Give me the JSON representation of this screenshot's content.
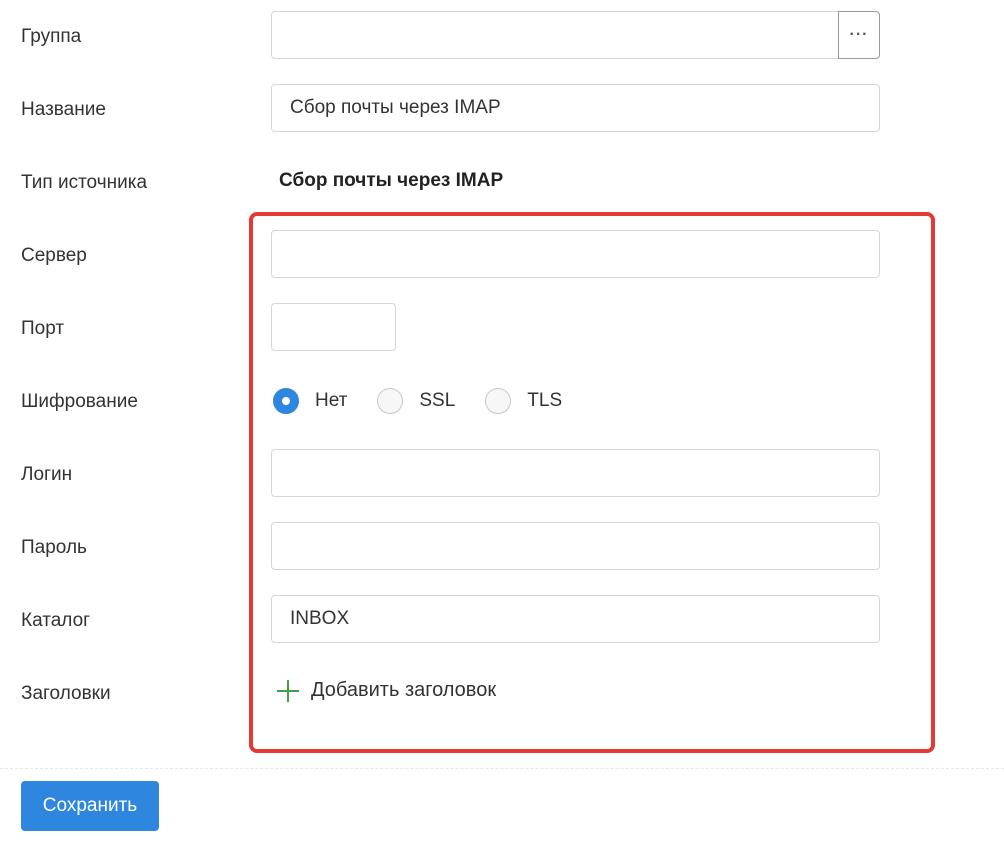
{
  "form": {
    "group": {
      "label": "Группа",
      "value": "",
      "browse_button": "···"
    },
    "name": {
      "label": "Название",
      "value": "Сбор почты через IMAP"
    },
    "source_type": {
      "label": "Тип источника",
      "value": "Сбор почты через IMAP"
    },
    "server": {
      "label": "Сервер",
      "value": ""
    },
    "port": {
      "label": "Порт",
      "value": ""
    },
    "encryption": {
      "label": "Шифрование",
      "options": [
        "Нет",
        "SSL",
        "TLS"
      ],
      "selected": "Нет"
    },
    "login": {
      "label": "Логин",
      "value": ""
    },
    "password": {
      "label": "Пароль",
      "value": ""
    },
    "folder": {
      "label": "Каталог",
      "value": "INBOX"
    },
    "headers": {
      "label": "Заголовки",
      "add_label": "Добавить заголовок"
    }
  },
  "footer": {
    "save_label": "Сохранить"
  },
  "colors": {
    "accent": "#2e86de",
    "highlight_border": "#e53935",
    "add_icon": "#43a047"
  },
  "icons": {
    "browse": "ellipsis-icon",
    "add": "plus-icon"
  }
}
